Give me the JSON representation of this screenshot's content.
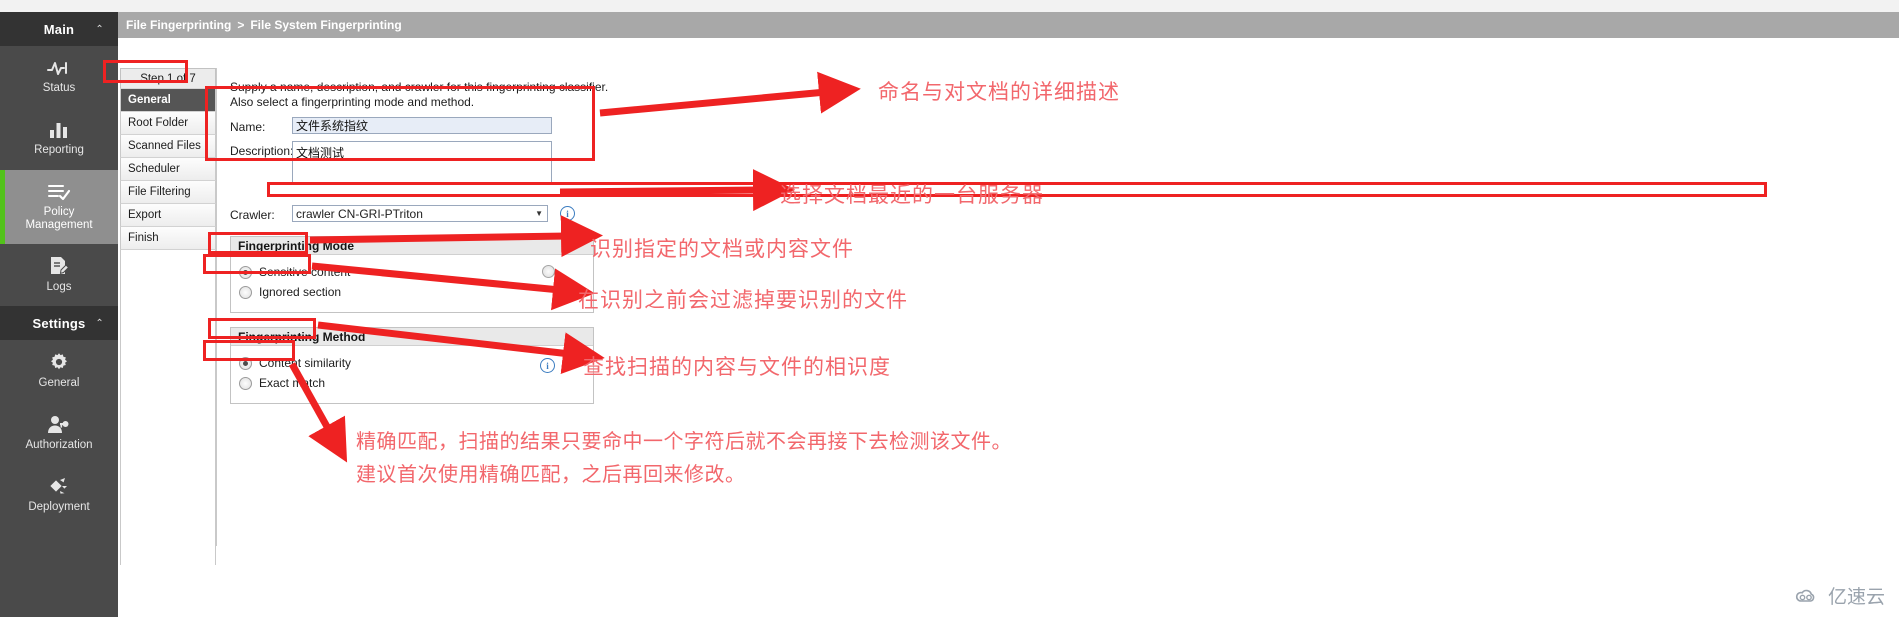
{
  "sidebar": {
    "groups": [
      {
        "header": "Main",
        "caret": "⌃",
        "items": [
          {
            "label": "Status",
            "icon": "activity-pulse-icon",
            "active": false
          },
          {
            "label": "Reporting",
            "icon": "bar-chart-icon",
            "active": false
          },
          {
            "label": "Policy\nManagement",
            "icon": "checklist-icon",
            "active": true
          },
          {
            "label": "Logs",
            "icon": "log-document-icon",
            "active": false
          }
        ]
      },
      {
        "header": "Settings",
        "caret": "⌃",
        "items": [
          {
            "label": "General",
            "icon": "gear-icon",
            "active": false
          },
          {
            "label": "Authorization",
            "icon": "user-key-icon",
            "active": false
          },
          {
            "label": "Deployment",
            "icon": "deployment-nodes-icon",
            "active": false
          }
        ]
      }
    ]
  },
  "breadcrumb": {
    "root": "File Fingerprinting",
    "separator": ">",
    "current": "File System Fingerprinting"
  },
  "wizard": {
    "step_counter": "Step 1 of 7",
    "steps": [
      {
        "label": "General",
        "selected": true
      },
      {
        "label": "Root Folder",
        "selected": false
      },
      {
        "label": "Scanned Files",
        "selected": false
      },
      {
        "label": "Scheduler",
        "selected": false
      },
      {
        "label": "File Filtering",
        "selected": false
      },
      {
        "label": "Export",
        "selected": false
      },
      {
        "label": "Finish",
        "selected": false
      }
    ]
  },
  "form": {
    "intro_line1": "Supply a name, description, and crawler for this fingerprinting classifier.",
    "intro_line2": "Also select a fingerprinting mode and method.",
    "name_label": "Name:",
    "name_value": "文件系统指纹",
    "name_placeholder": "",
    "description_label": "Description:",
    "description_value": "文档测试",
    "description_placeholder": "",
    "crawler_label": "Crawler:",
    "crawler_value": "crawler CN-GRI-PTriton",
    "crawler_arrow": "▼",
    "info_glyph": "i",
    "mode_group": {
      "title": "Fingerprinting Mode",
      "options": [
        {
          "label": "Sensitive content",
          "checked": true
        },
        {
          "label": "Ignored section",
          "checked": false
        }
      ]
    },
    "method_group": {
      "title": "Fingerprinting Method",
      "options": [
        {
          "label": "Content similarity",
          "checked": true
        },
        {
          "label": "Exact match",
          "checked": false
        }
      ]
    }
  },
  "annotations": {
    "accent_color": "#ee2222",
    "text_color": "#f2676c",
    "naming": "命名与对文档的详细描述",
    "crawler": "选择文档最近的一台服务器",
    "sensitive": "识别指定的文档或内容文件",
    "ignored": "在识别之前会过滤掉要识别的文件",
    "similarity": "查找扫描的内容与文件的相识度",
    "exact_line1": "精确匹配，扫描的结果只要命中一个字符后就不会再接下去检测该文件。",
    "exact_line2": "建议首次使用精确匹配，之后再回来修改。"
  },
  "watermark": {
    "text": "亿速云",
    "icon": "cloud-logo-icon"
  }
}
